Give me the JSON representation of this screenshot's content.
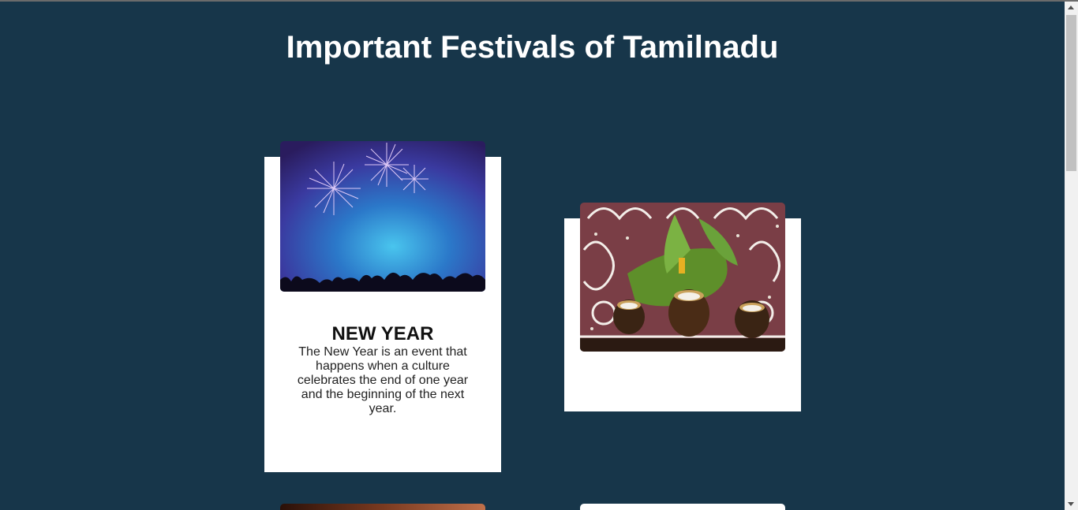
{
  "page": {
    "title": "Important Festivals of Tamilnadu"
  },
  "cards": [
    {
      "image": "fireworks-photo",
      "title": "NEW YEAR",
      "text": "The New Year is an event that happens when a culture celebrates the end of one year and the beginning of the next year."
    },
    {
      "image": "pongal-pots-photo",
      "title": "",
      "text": ""
    }
  ],
  "colors": {
    "background": "#17364a",
    "card": "#ffffff",
    "heading": "#ffffff"
  }
}
